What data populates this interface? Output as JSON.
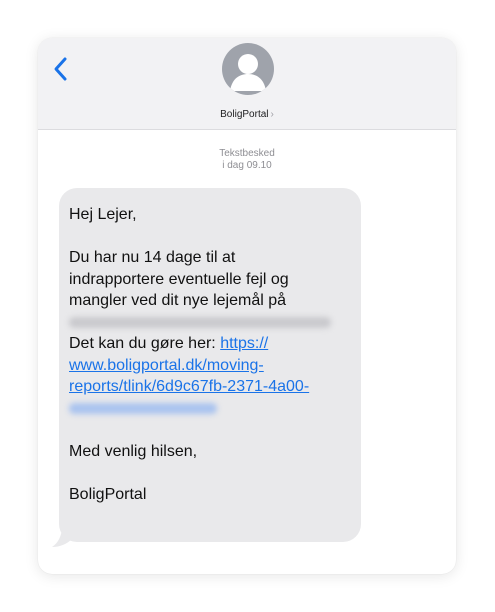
{
  "header": {
    "contact_name": "BoligPortal",
    "contact_chevron": "›"
  },
  "icons": {
    "back": "chevron-left-icon",
    "avatar": "person-silhouette-icon"
  },
  "meta": {
    "message_type": "Tekstbesked",
    "timestamp": "i dag 09.10"
  },
  "message": {
    "greeting": "Hej Lejer,",
    "body_line1": "Du har nu 14 dage til at",
    "body_line2": "indrapportere eventuelle fejl og",
    "body_line3": "mangler ved dit nye lejemål på",
    "cta_text": "Det kan du gøre her: ",
    "link_line1": "https://",
    "link_line2": "www.boligportal.dk/moving-",
    "link_line3": "reports/tlink/6d9c67fb-2371-4a00-",
    "signoff": "Med venlig hilsen,",
    "signature": "BoligPortal"
  },
  "colors": {
    "accent": "#1a73e8",
    "bubble": "#e9e9eb",
    "header_bg": "#f2f2f4",
    "meta_text": "#8e8e93"
  }
}
